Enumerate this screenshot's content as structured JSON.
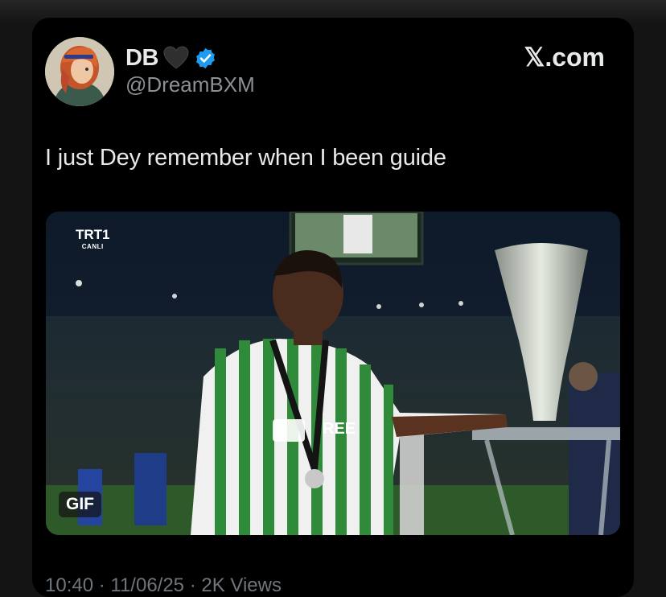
{
  "tweet": {
    "display_name": "DB",
    "name_emoji_icon": "black-heart-icon",
    "verified_icon": "verified-badge-icon",
    "handle": "@DreamBXM",
    "brand": "𝕏.com",
    "text": "I just Dey remember when I been guide",
    "media": {
      "badge": "GIF",
      "broadcaster_logo": "TRT",
      "broadcaster_logo_num": "1",
      "broadcaster_sub": "CANLI",
      "shirt_sponsor": "REE"
    },
    "footer_meta": "10:40 · 11/06/25 · 2K Views"
  },
  "colors": {
    "background": "#000000",
    "text_primary": "#e7e9ea",
    "text_secondary": "#8b9197",
    "verified_blue": "#1d9bf0"
  }
}
